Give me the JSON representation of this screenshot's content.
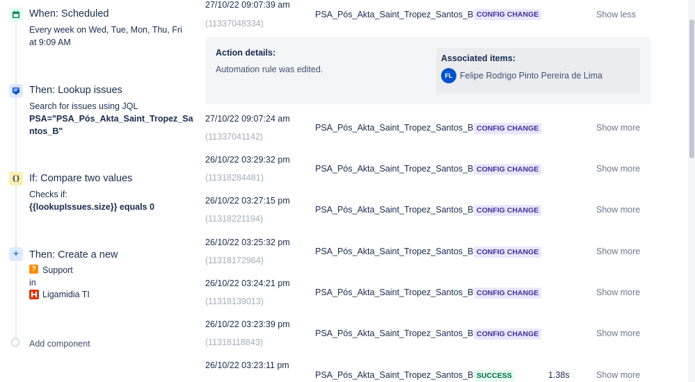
{
  "components": {
    "trigger": {
      "title": "When: Scheduled",
      "line1": "Every week on Wed, Tue, Mon, Thu, Fri",
      "line2": "at 9:09 AM"
    },
    "lookup": {
      "title": "Then: Lookup issues",
      "desc": "Search for issues using JQL",
      "jql": "PSA=\"PSA_Pós_Akta_Saint_Tropez_Sa",
      "jql2": "ntos_B\""
    },
    "condition": {
      "title": "If: Compare two values",
      "desc": "Checks if:",
      "expr": "{{lookupIssues.size}} equals 0"
    },
    "action": {
      "title": "Then: Create a new",
      "issue_type": "Support",
      "in": "in",
      "project": "Ligamidia TI"
    },
    "add_component": "Add component"
  },
  "log": {
    "rows": [
      {
        "time": "27/10/22 09:07:39 am",
        "id": "(11337048334)",
        "rule": "PSA_Pós_Akta_Saint_Tropez_Santos_B",
        "status": "CONFIG CHANGE",
        "toggle": "Show less"
      },
      {
        "time": "27/10/22 09:07:24 am",
        "id": "(11337041142)",
        "rule": "PSA_Pós_Akta_Saint_Tropez_Santos_B",
        "status": "CONFIG CHANGE",
        "toggle": "Show more"
      },
      {
        "time": "26/10/22 03:29:32 pm",
        "id": "(11318284481)",
        "rule": "PSA_Pós_Akta_Saint_Tropez_Santos_B",
        "status": "CONFIG CHANGE",
        "toggle": "Show more"
      },
      {
        "time": "26/10/22 03:27:15 pm",
        "id": "(11318221194)",
        "rule": "PSA_Pós_Akta_Saint_Tropez_Santos_B",
        "status": "CONFIG CHANGE",
        "toggle": "Show more"
      },
      {
        "time": "26/10/22 03:25:32 pm",
        "id": "(11318172964)",
        "rule": "PSA_Pós_Akta_Saint_Tropez_Santos_B",
        "status": "CONFIG CHANGE",
        "toggle": "Show more"
      },
      {
        "time": "26/10/22 03:24:21 pm",
        "id": "(11318139013)",
        "rule": "PSA_Pós_Akta_Saint_Tropez_Santos_B",
        "status": "CONFIG CHANGE",
        "toggle": "Show more"
      },
      {
        "time": "26/10/22 03:23:39 pm",
        "id": "(11318118843)",
        "rule": "PSA_Pós_Akta_Saint_Tropez_Santos_B",
        "status": "CONFIG CHANGE",
        "toggle": "Show more"
      },
      {
        "time": "26/10/22 03:23:11 pm",
        "id": "",
        "rule": "PSA_Pós_Akta_Saint_Tropez_Santos_B",
        "status": "SUCCESS",
        "duration": "1.38s",
        "toggle": "Show more"
      }
    ],
    "details": {
      "heading": "Action details:",
      "text": "Automation rule was edited.",
      "assoc_heading": "Associated items:",
      "avatar_initials": "FL",
      "user": "Felipe Rodrigo Pinto Pereira de Lima"
    }
  },
  "colors": {
    "config_bg": "#EAE6FF",
    "config_fg": "#403294",
    "success_bg": "#E3FCEF",
    "success_fg": "#006644"
  }
}
